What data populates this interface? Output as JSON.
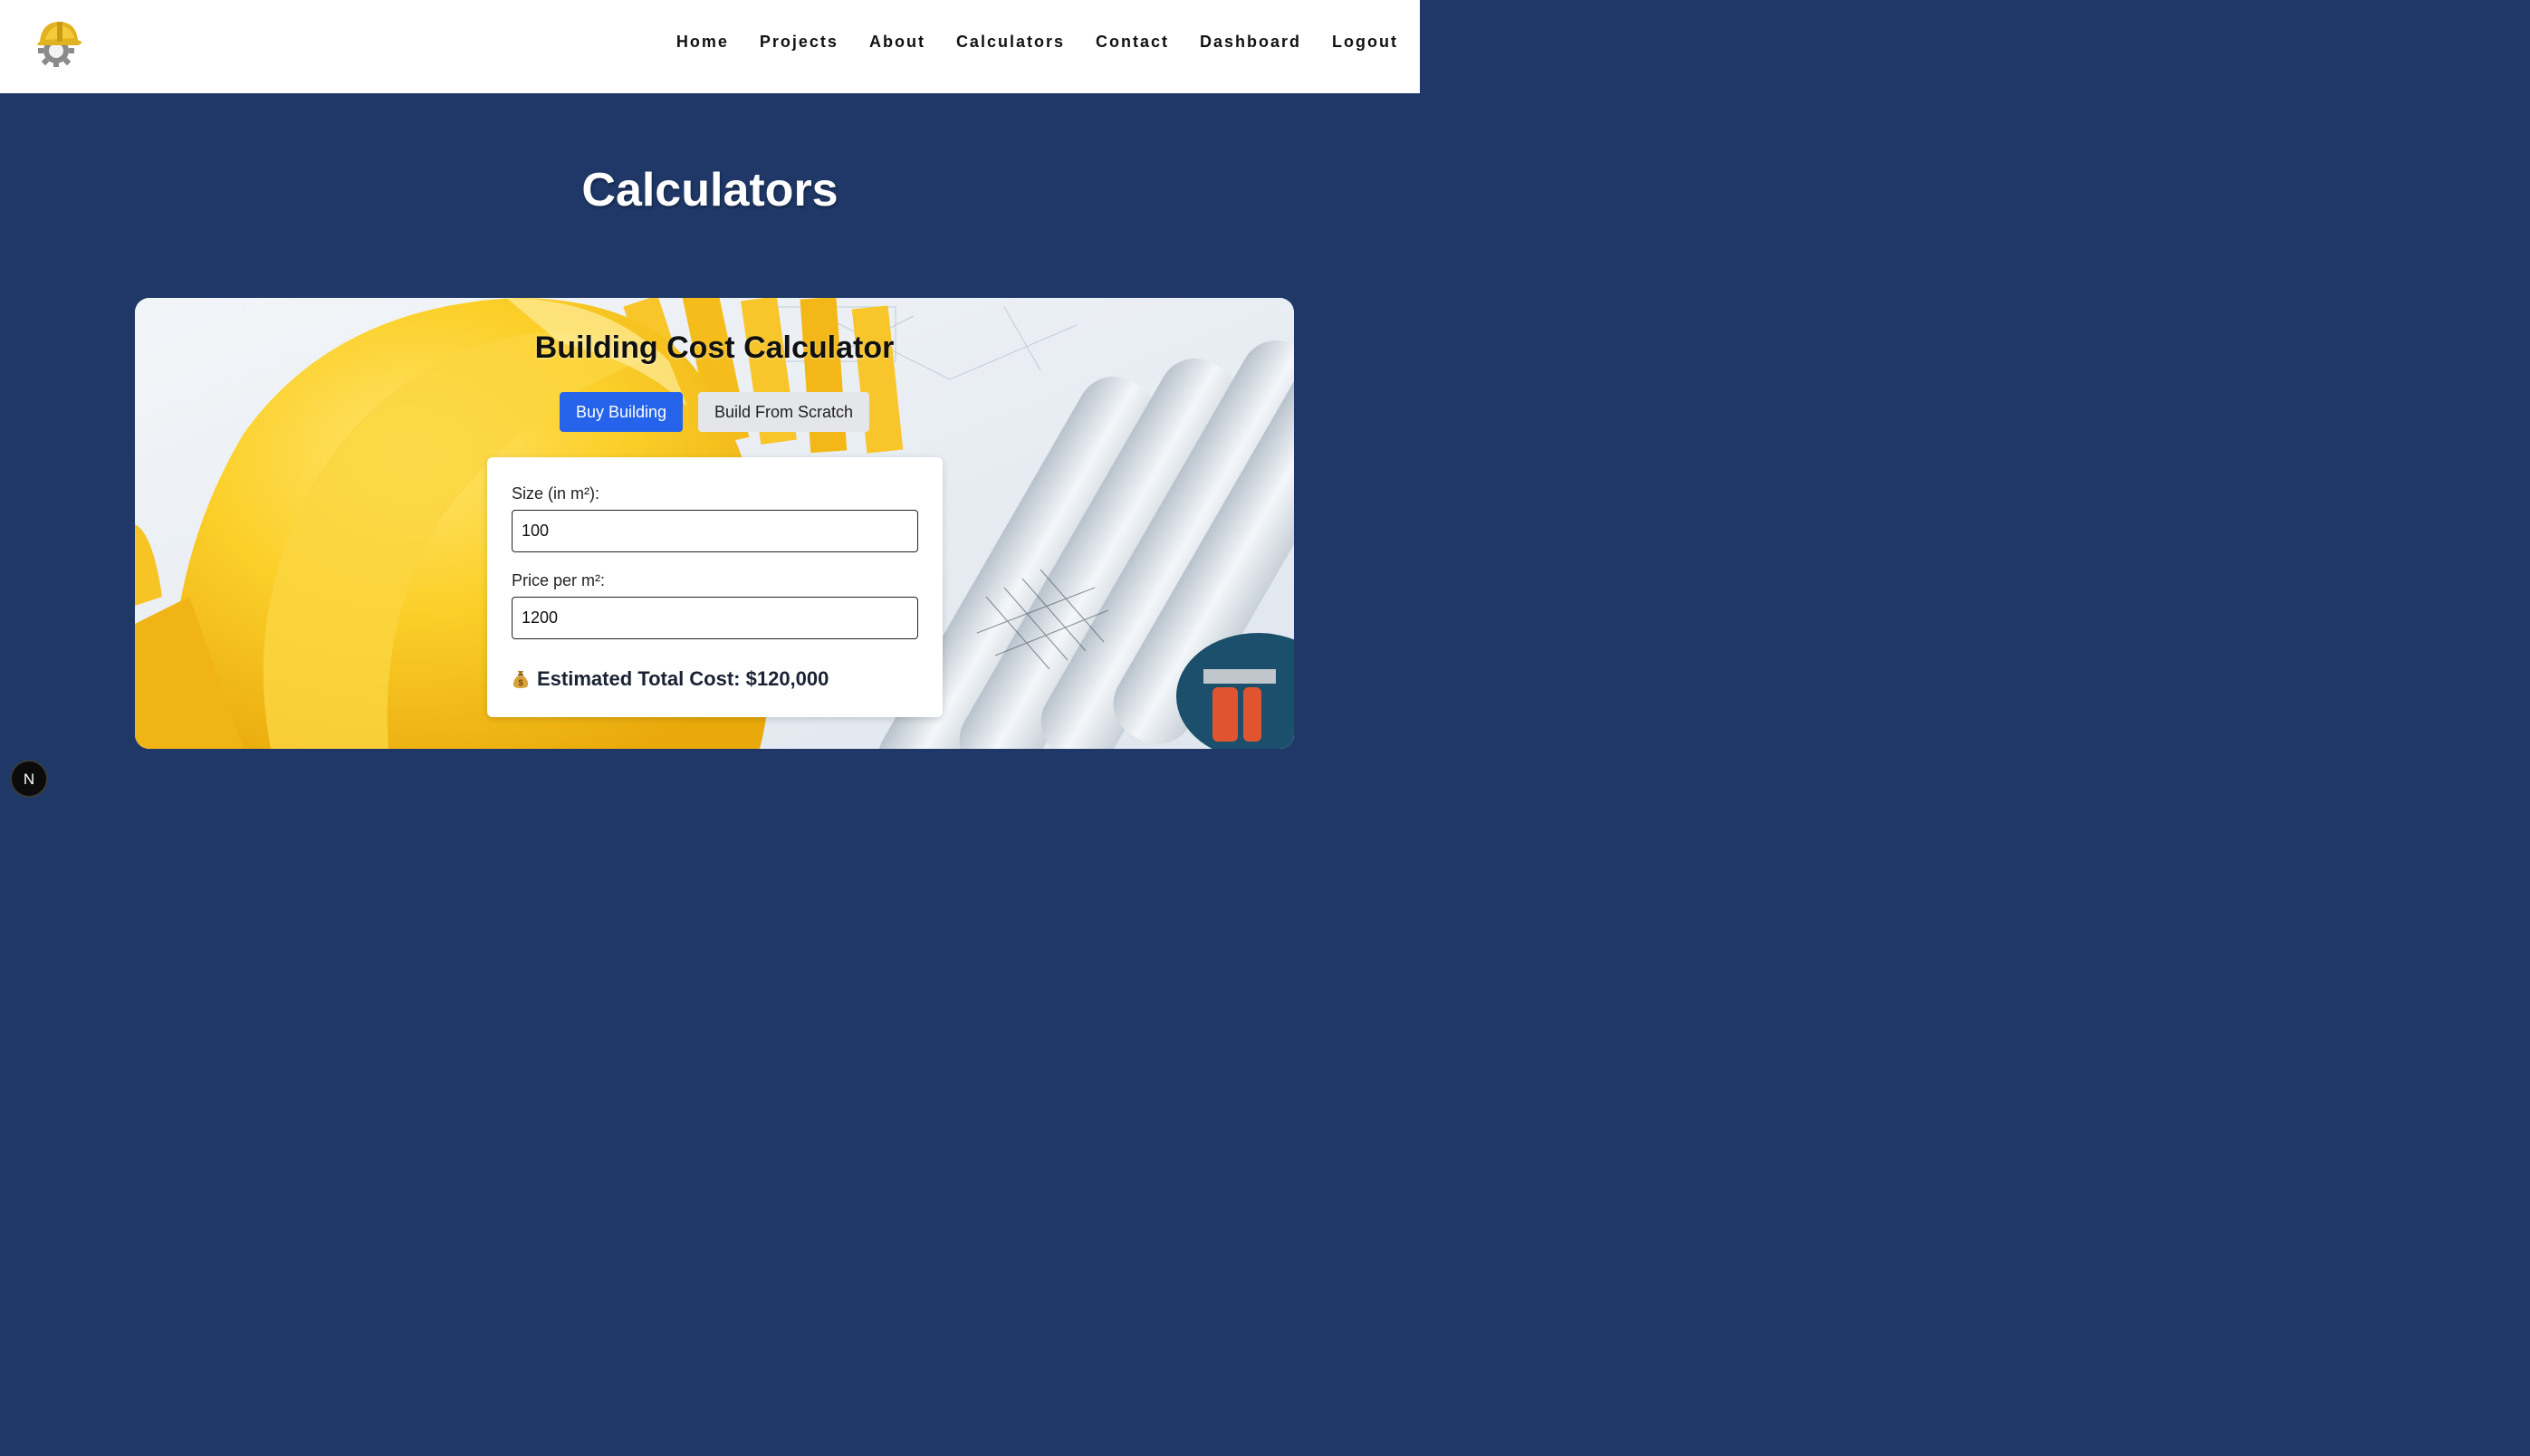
{
  "nav": {
    "logo_icon": "hardhat-gear-logo-icon",
    "links": [
      "Home",
      "Projects",
      "About",
      "Calculators",
      "Contact",
      "Dashboard",
      "Logout"
    ]
  },
  "page": {
    "title": "Calculators"
  },
  "calculator": {
    "title": "Building Cost Calculator",
    "tabs": {
      "buy": "Buy Building",
      "scratch": "Build From Scratch",
      "active": "buy"
    },
    "fields": {
      "size_label": "Size (in m²):",
      "size_value": "100",
      "price_label": "Price per m²:",
      "price_value": "1200"
    },
    "result": {
      "icon": "money-bag-icon",
      "text": "Estimated Total Cost: $120,000"
    }
  },
  "dev_badge": {
    "letter": "N"
  },
  "colors": {
    "page_bg": "#1f3868",
    "primary_button": "#2563eb",
    "secondary_button": "#e4e6ea",
    "hardhat_yellow": "#f7c31a"
  }
}
